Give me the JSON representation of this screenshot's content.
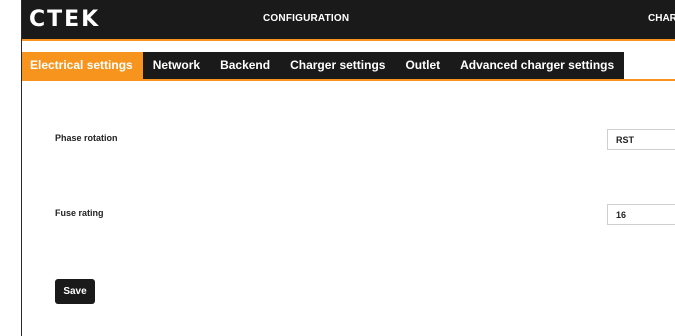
{
  "header": {
    "logo_text": "CTEK",
    "title": "CONFIGURATION",
    "right_label": "CHARG"
  },
  "tabs": [
    {
      "label": "Electrical settings",
      "active": true
    },
    {
      "label": "Network",
      "active": false
    },
    {
      "label": "Backend",
      "active": false
    },
    {
      "label": "Charger settings",
      "active": false
    },
    {
      "label": "Outlet",
      "active": false
    },
    {
      "label": "Advanced charger settings",
      "active": false
    }
  ],
  "fields": {
    "phase_rotation": {
      "label": "Phase rotation",
      "value": "RST"
    },
    "fuse_rating": {
      "label": "Fuse rating",
      "value": "16"
    }
  },
  "actions": {
    "save_label": "Save"
  },
  "colors": {
    "accent": "#f7941d",
    "header_bg": "#1a1a1a",
    "text": "#222222"
  }
}
